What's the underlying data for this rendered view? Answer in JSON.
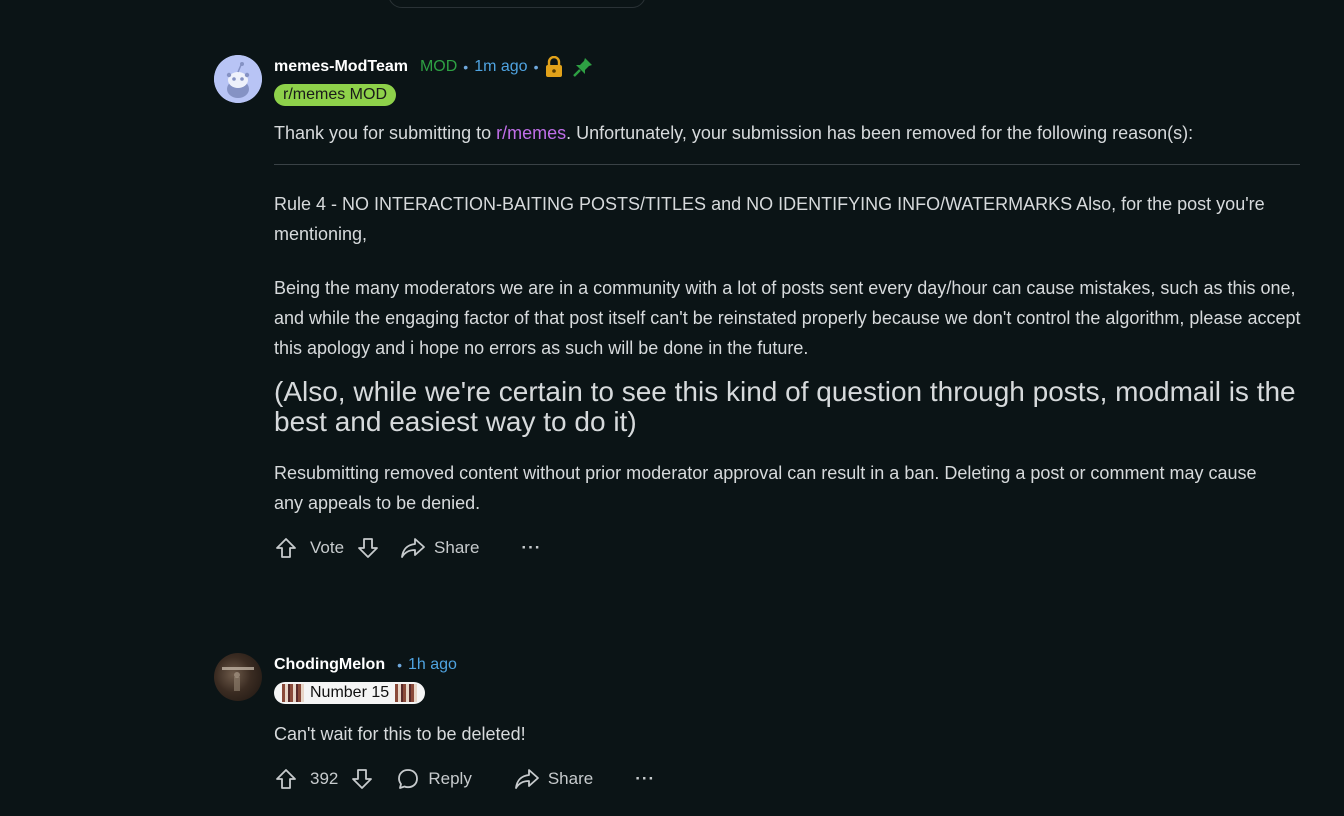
{
  "mod_comment": {
    "author": "memes-ModTeam",
    "mod_label": "MOD",
    "dot": "•",
    "time": "1m ago",
    "flair": "r/memes MOD",
    "intro_before": "Thank you for submitting to ",
    "intro_link": "r/memes",
    "intro_after": ". Unfortunately, your submission has been removed for the following reason(s):",
    "rule": "Rule 4 - NO INTERACTION-BAITING POSTS/TITLES and NO IDENTIFYING INFO/WATERMARKS Also, for the post you're mentioning,",
    "apology": "Being the many moderators we are in a community with a lot of posts sent every day/hour can cause mistakes, such as this one, and while the engaging factor of that post itself can't be reinstated properly because we don't control the algorithm, please accept this apology and i hope no errors as such will be done in the future.",
    "note": "(Also, while we're certain to see this kind of question through posts, modmail is the best and easiest way to do it)",
    "warning": "Resubmitting removed content without prior moderator approval can result in a ban. Deleting a post or comment may cause any appeals to be denied.",
    "actions": {
      "vote": "Vote",
      "share": "Share",
      "more": "···"
    },
    "icons": {
      "lock": "lock-icon",
      "pin": "pin-icon"
    }
  },
  "user_comment": {
    "author": "ChodingMelon",
    "dot": "•",
    "time": "1h ago",
    "flair": "Number 15",
    "text": "Can't wait for this to be deleted!",
    "actions": {
      "score": "392",
      "reply": "Reply",
      "share": "Share",
      "more": "···"
    }
  },
  "colors": {
    "background": "#0b1416",
    "mod_green": "#2ea043",
    "time_blue": "#4fa3e0",
    "link_purple": "#c06ee8",
    "flair_green": "#8ed14a"
  }
}
